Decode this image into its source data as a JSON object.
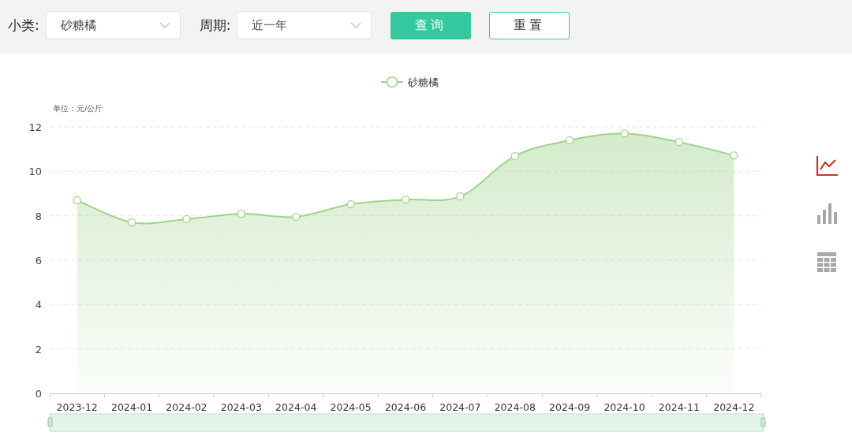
{
  "filters": [
    {
      "label": "小类:",
      "value": "砂糖橘"
    },
    {
      "label": "周期:",
      "value": "近一年"
    }
  ],
  "buttons": [
    {
      "label": "查询",
      "kind": "primary"
    },
    {
      "label": "重置",
      "kind": "secondary"
    }
  ],
  "chart": {
    "chart_data": {
      "type": "area",
      "ylabel": "单位：元/公斤",
      "categories": [
        "2023-12",
        "2024-01",
        "2024-02",
        "2024-03",
        "2024-04",
        "2024-05",
        "2024-06",
        "2024-07",
        "2024-08",
        "2024-09",
        "2024-10",
        "2024-11",
        "2024-12"
      ],
      "series": [
        {
          "name": "砂糖橘",
          "color": "#9fd38c",
          "values": [
            8.7,
            7.7,
            7.85,
            8.09,
            7.95,
            8.52,
            8.73,
            8.87,
            10.69,
            11.4,
            11.71,
            11.32,
            10.72
          ]
        }
      ],
      "grid": true,
      "ylim": [
        0,
        12
      ],
      "yticks": [
        0,
        2,
        4,
        6,
        8,
        10,
        12
      ]
    }
  },
  "toolbox": [
    {
      "kind": "line",
      "selected": true
    },
    {
      "kind": "bar",
      "selected": false
    },
    {
      "kind": "table",
      "selected": false
    }
  ]
}
